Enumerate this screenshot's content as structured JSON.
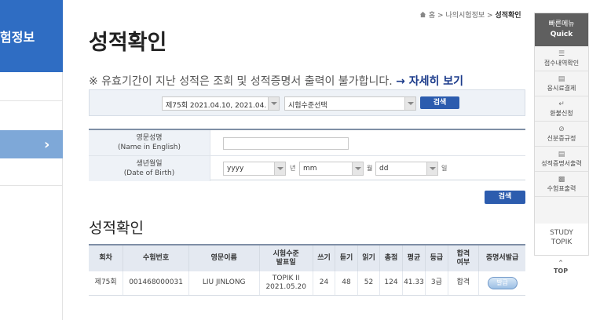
{
  "sidebar": {
    "heading": "험정보",
    "active_chevron": "chevron-right-icon"
  },
  "breadcrumb": {
    "home": "홈",
    "sep": ">",
    "parent": "나의시험정보",
    "current": "성적확인"
  },
  "page_title": "성적확인",
  "notice": {
    "text": "※ 유효기간이 지난 성적은 조회 및 성적증명서 출력이 불가합니다.",
    "link": "→ 자세히 보기"
  },
  "filter": {
    "exam_select": "제75회 2021.04.10, 2021.04.",
    "level_select": "시험수준선택",
    "search_label": "검색"
  },
  "form": {
    "name_label_ko": "영문성명",
    "name_label_en": "(Name in English)",
    "name_value": "",
    "dob_label_ko": "생년월일",
    "dob_label_en": "(Date of Birth)",
    "year_select": "yyyy",
    "year_unit": "년",
    "month_select": "mm",
    "month_unit": "월",
    "day_select": "dd",
    "day_unit": "일",
    "search_label": "검색"
  },
  "results": {
    "title": "성적확인",
    "headers": [
      "회차",
      "수험번호",
      "영문이름",
      "시험수준 발표일",
      "쓰기",
      "듣기",
      "읽기",
      "총점",
      "평균",
      "등급",
      "합격 여부",
      "증명서발급"
    ],
    "rows": [
      {
        "round": "제75회",
        "exam_no": "001468000031",
        "name": "LIU JINLONG",
        "level": "TOPIK II",
        "announce": "2021.05.20",
        "writing": "24",
        "listening": "48",
        "reading": "52",
        "total": "124",
        "average": "41.33",
        "grade": "3급",
        "pass": "합격",
        "issue": "발급"
      }
    ]
  },
  "quick": {
    "head_ko": "빠른메뉴",
    "head_en": "Quick",
    "items": [
      {
        "label": "접수내역확인",
        "icon": "list-icon"
      },
      {
        "label": "응시료결제",
        "icon": "card-icon"
      },
      {
        "label": "환불신청",
        "icon": "return-icon"
      },
      {
        "label": "신분증규정",
        "icon": "prohibit-icon"
      },
      {
        "label": "성적증명서출력",
        "icon": "certificate-icon"
      },
      {
        "label": "수험표출력",
        "icon": "printer-icon"
      }
    ],
    "study_1": "STUDY",
    "study_2": "TOPIK",
    "top_label": "TOP"
  }
}
